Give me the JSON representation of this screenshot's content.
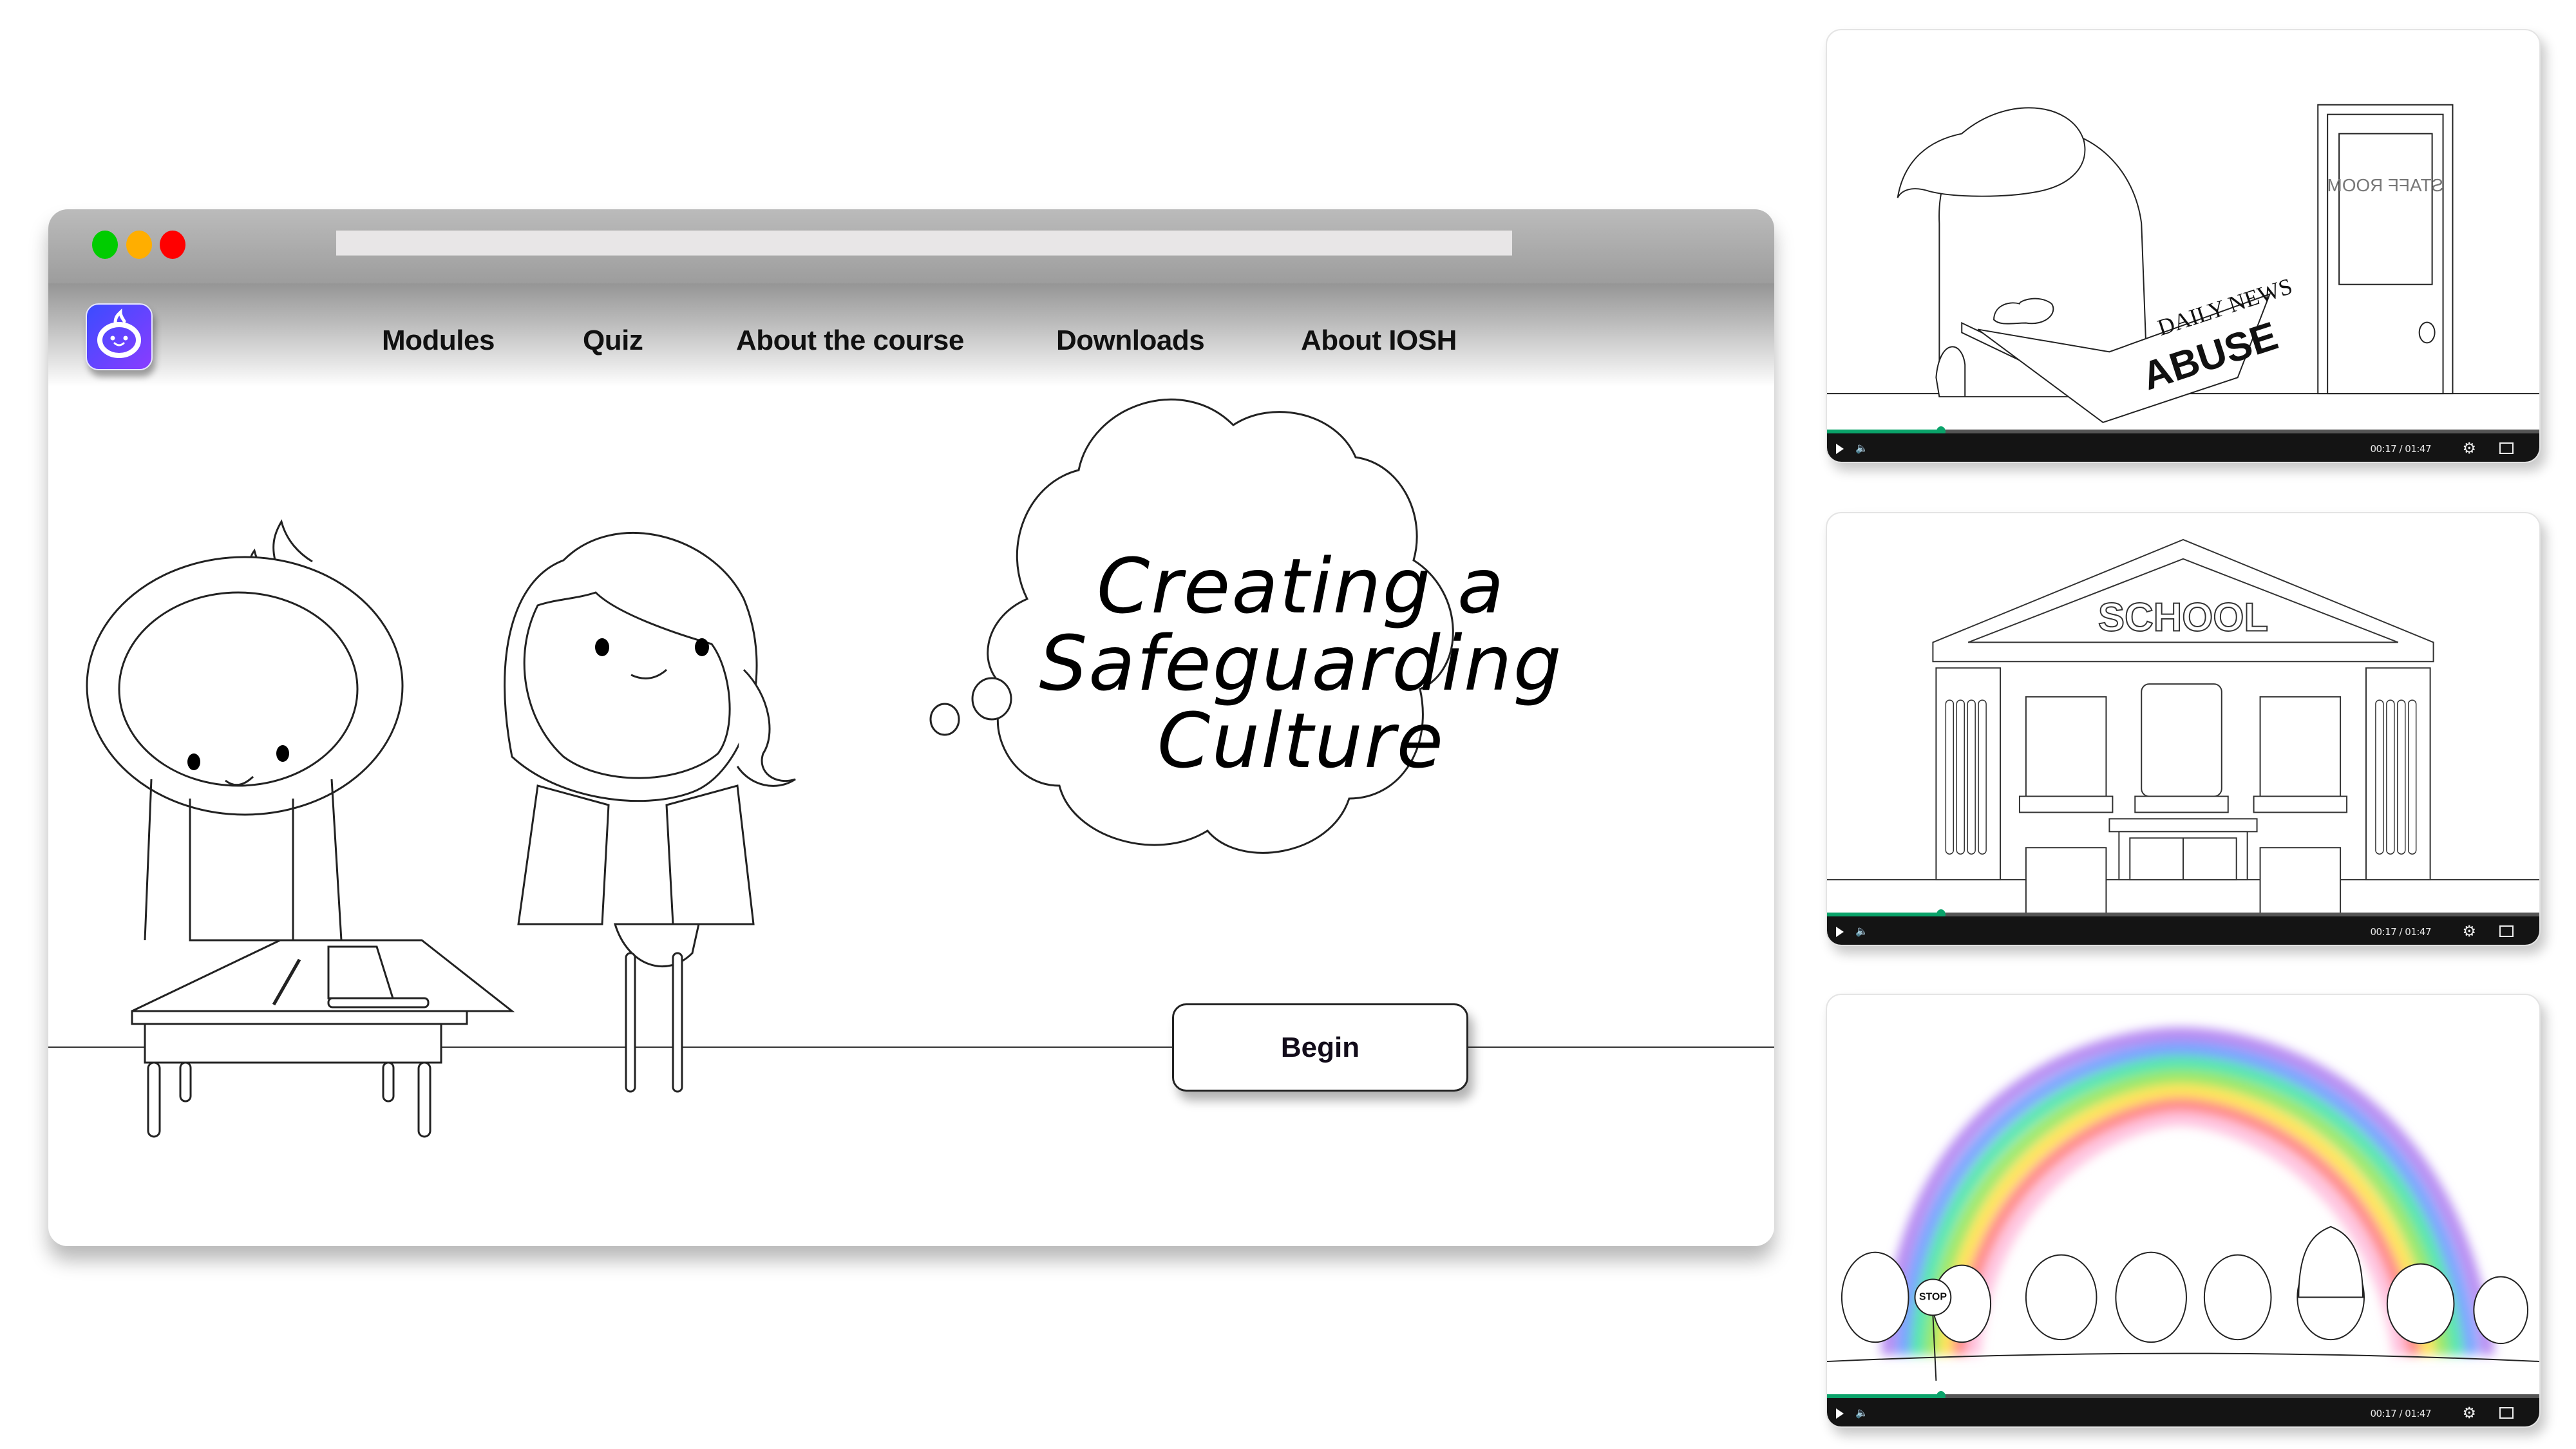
{
  "browser": {
    "window_controls": [
      {
        "name": "green",
        "color": "#00cc00"
      },
      {
        "name": "yellow",
        "color": "#ffae00"
      },
      {
        "name": "red",
        "color": "#ff0000"
      }
    ],
    "address_bar_value": "",
    "logo_icon": "robot-face-icon",
    "brand_colors": {
      "logo_from": "#3b4cff",
      "logo_to": "#8a3cff"
    },
    "nav": [
      {
        "label": "Modules"
      },
      {
        "label": "Quiz"
      },
      {
        "label": "About the course"
      },
      {
        "label": "Downloads"
      },
      {
        "label": "About IOSH"
      }
    ]
  },
  "hero": {
    "title_lines": [
      "Creating a",
      "Safeguarding",
      "Culture"
    ],
    "begin_label": "Begin"
  },
  "videos": [
    {
      "scene": "Woman in glasses reading newspaper beside staff room door",
      "newspaper_masthead": "DAILY NEWS",
      "newspaper_headline": "ABUSE",
      "door_sign": "STAFF ROOM",
      "time_label": "00:17 / 01:47",
      "progress": 0.16,
      "accent": "#0aa36a"
    },
    {
      "scene": "School building with characters in windows",
      "building_sign": "SCHOOL",
      "time_label": "00:17 / 01:47",
      "progress": 0.16,
      "accent": "#0aa36a"
    },
    {
      "scene": "Group of characters standing under a rainbow",
      "sign_text": "STOP",
      "time_label": "00:17 / 01:47",
      "progress": 0.16,
      "accent": "#0aa36a"
    }
  ],
  "icons": {
    "play": "play-icon",
    "volume": "volume-icon",
    "settings": "gear-icon",
    "fullscreen": "fullscreen-icon"
  }
}
